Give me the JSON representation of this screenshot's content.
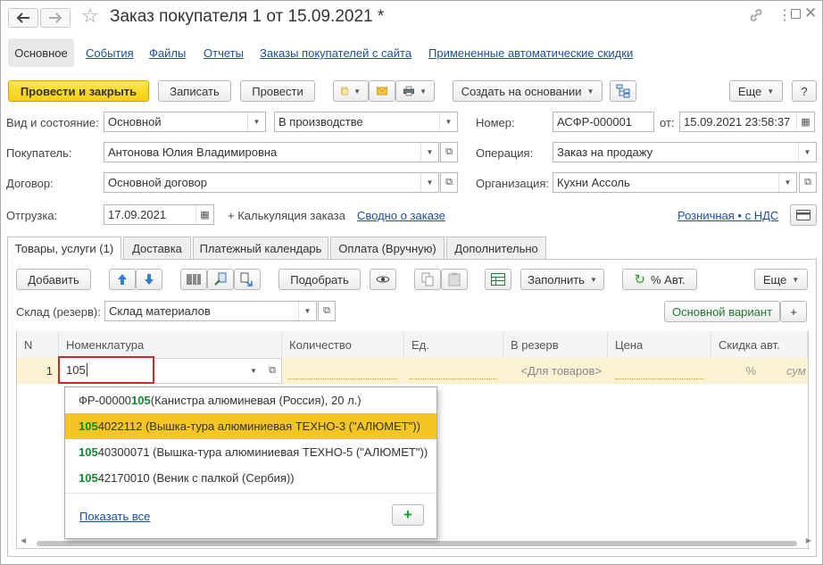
{
  "window": {
    "title": "Заказ покупателя 1 от 15.09.2021 *"
  },
  "nav_tabs": [
    {
      "label": "Основное"
    },
    {
      "label": "События"
    },
    {
      "label": "Файлы"
    },
    {
      "label": "Отчеты"
    },
    {
      "label": "Заказы покупателей с сайта"
    },
    {
      "label": "Примененные автоматические скидки"
    }
  ],
  "toolbar": {
    "post_close": "Провести и закрыть",
    "save": "Записать",
    "post": "Провести",
    "create_based": "Создать на основании",
    "more": "Еще",
    "help": "?"
  },
  "form": {
    "status_label": "Вид и состояние:",
    "status_kind": "Основной",
    "status_state": "В производстве",
    "number_label": "Номер:",
    "number_value": "АСФР-000001",
    "date_label": "от:",
    "date_value": "15.09.2021 23:58:37",
    "buyer_label": "Покупатель:",
    "buyer_value": "Антонова Юлия Владимировна",
    "operation_label": "Операция:",
    "operation_value": "Заказ на продажу",
    "contract_label": "Договор:",
    "contract_value": "Основной договор",
    "org_label": "Организация:",
    "org_value": "Кухни Ассоль",
    "shipment_label": "Отгрузка:",
    "shipment_value": "17.09.2021",
    "calc_label": "+ Калькуляция заказа",
    "summary_link": "Сводно о заказе",
    "price_link": "Розничная • с НДС"
  },
  "doc_tabs": [
    {
      "label": "Товары, услуги (1)"
    },
    {
      "label": "Доставка"
    },
    {
      "label": "Платежный календарь"
    },
    {
      "label": "Оплата (Вручную)"
    },
    {
      "label": "Дополнительно"
    }
  ],
  "table_toolbar": {
    "add": "Добавить",
    "pick": "Подобрать",
    "fill": "Заполнить",
    "auto": "% Авт.",
    "more": "Еще"
  },
  "warehouse": {
    "label": "Склад (резерв):",
    "value": "Склад материалов",
    "variant_button": "Основной вариант",
    "plus": "+"
  },
  "table": {
    "columns": [
      "N",
      "Номенклатура",
      "Количество",
      "Ед.",
      "В резерв",
      "Цена",
      "Скидка авт."
    ],
    "row": {
      "n": "1",
      "item_input": "105",
      "reserve": "<Для товаров>",
      "discount_pct": "%",
      "sum": "сум"
    }
  },
  "dropdown": {
    "items": [
      {
        "prefix": "ФР-00000",
        "match": "105",
        "suffix": " (Канистра алюминевая (Россия), 20 л.)"
      },
      {
        "prefix": "",
        "match": "105",
        "suffix": "4022112 (Вышка-тура алюминиевая ТЕХНО-3 (\"АЛЮМЕТ\"))"
      },
      {
        "prefix": "",
        "match": "105",
        "suffix": "40300071 (Вышка-тура алюминиевая ТЕХНО-5 (\"АЛЮМЕТ\"))"
      },
      {
        "prefix": "",
        "match": "105",
        "suffix": "42170010 (Веник с палкой (Сербия))"
      }
    ],
    "show_all": "Показать все",
    "add_plus": "+"
  },
  "colors": {
    "accent_yellow": "#f5cf13",
    "selection": "#f5c524",
    "match_green": "#0a8b2c",
    "link_blue": "#1c4fa0",
    "highlight_red": "#d0282a"
  }
}
